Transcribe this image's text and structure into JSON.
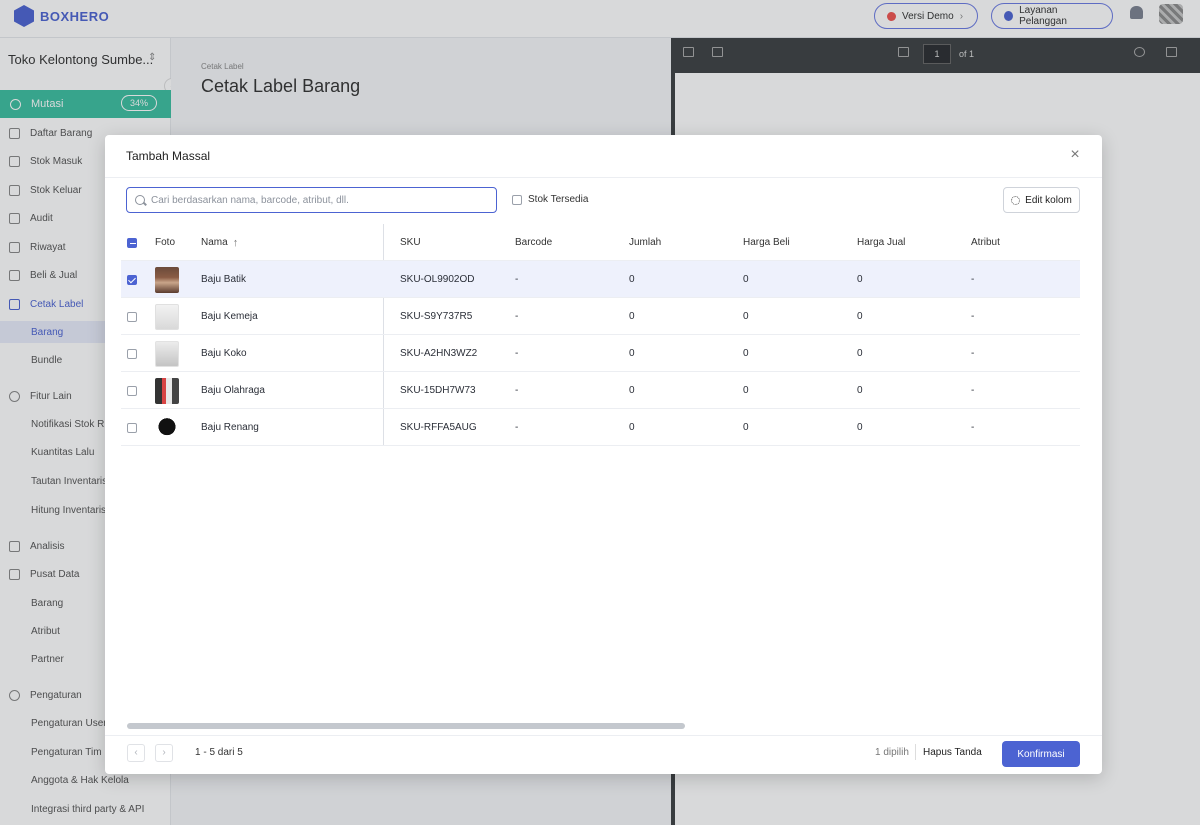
{
  "app": {
    "logo": "BOXHERO",
    "demo_button": "Versi Demo",
    "support_button": "Layanan Pelanggan"
  },
  "sidebar": {
    "store_name": "Toko Kelontong Sumbe...",
    "mutasi": {
      "label": "Mutasi",
      "progress": "34%"
    },
    "items": [
      {
        "label": "Daftar Barang"
      },
      {
        "label": "Stok Masuk"
      },
      {
        "label": "Stok Keluar"
      },
      {
        "label": "Audit"
      },
      {
        "label": "Riwayat"
      },
      {
        "label": "Beli & Jual"
      },
      {
        "label": "Cetak Label"
      },
      {
        "label": "Barang"
      },
      {
        "label": "Bundle"
      },
      {
        "label": "Fitur Lain"
      },
      {
        "label": "Notifikasi Stok R"
      },
      {
        "label": "Kuantitas Lalu"
      },
      {
        "label": "Tautan Inventaris"
      },
      {
        "label": "Hitung Inventaris"
      },
      {
        "label": "Analisis"
      },
      {
        "label": "Pusat Data"
      },
      {
        "label": "Barang"
      },
      {
        "label": "Atribut"
      },
      {
        "label": "Partner"
      },
      {
        "label": "Pengaturan"
      },
      {
        "label": "Pengaturan User"
      },
      {
        "label": "Pengaturan Tim"
      },
      {
        "label": "Anggota & Hak Kelola"
      },
      {
        "label": "Integrasi third party & API"
      }
    ]
  },
  "page": {
    "breadcrumb": "Cetak Label",
    "title": "Cetak Label Barang"
  },
  "pdf_viewer": {
    "page": "1",
    "of": "of 1"
  },
  "modal": {
    "title": "Tambah Massal",
    "search_placeholder": "Cari berdasarkan nama, barcode, atribut, dll.",
    "stock_filter": "Stok Tersedia",
    "edit_columns": "Edit kolom",
    "columns": {
      "foto": "Foto",
      "nama": "Nama",
      "sku": "SKU",
      "barcode": "Barcode",
      "jumlah": "Jumlah",
      "harga_beli": "Harga Beli",
      "harga_jual": "Harga Jual",
      "atribut": "Atribut"
    },
    "rows": [
      {
        "name": "Baju Batik",
        "sku": "SKU-OL9902OD",
        "barcode": "-",
        "jumlah": "0",
        "harga_beli": "0",
        "harga_jual": "0",
        "atribut": "-"
      },
      {
        "name": "Baju Kemeja",
        "sku": "SKU-S9Y737R5",
        "barcode": "-",
        "jumlah": "0",
        "harga_beli": "0",
        "harga_jual": "0",
        "atribut": "-"
      },
      {
        "name": "Baju Koko",
        "sku": "SKU-A2HN3WZ2",
        "barcode": "-",
        "jumlah": "0",
        "harga_beli": "0",
        "harga_jual": "0",
        "atribut": "-"
      },
      {
        "name": "Baju Olahraga",
        "sku": "SKU-15DH7W73",
        "barcode": "-",
        "jumlah": "0",
        "harga_beli": "0",
        "harga_jual": "0",
        "atribut": "-"
      },
      {
        "name": "Baju Renang",
        "sku": "SKU-RFFA5AUG",
        "barcode": "-",
        "jumlah": "0",
        "harga_beli": "0",
        "harga_jual": "0",
        "atribut": "-"
      }
    ],
    "pagination": {
      "prev": "‹",
      "next": "›",
      "range": "1 - 5 dari 5"
    },
    "selected_count": "1 dipilih",
    "clear_selection": "Hapus Tanda",
    "confirm": "Konfirmasi"
  },
  "colors": {
    "accent": "#4c63d2",
    "mutasi": "#3bbfa0",
    "selected_row": "#eef1fc"
  }
}
